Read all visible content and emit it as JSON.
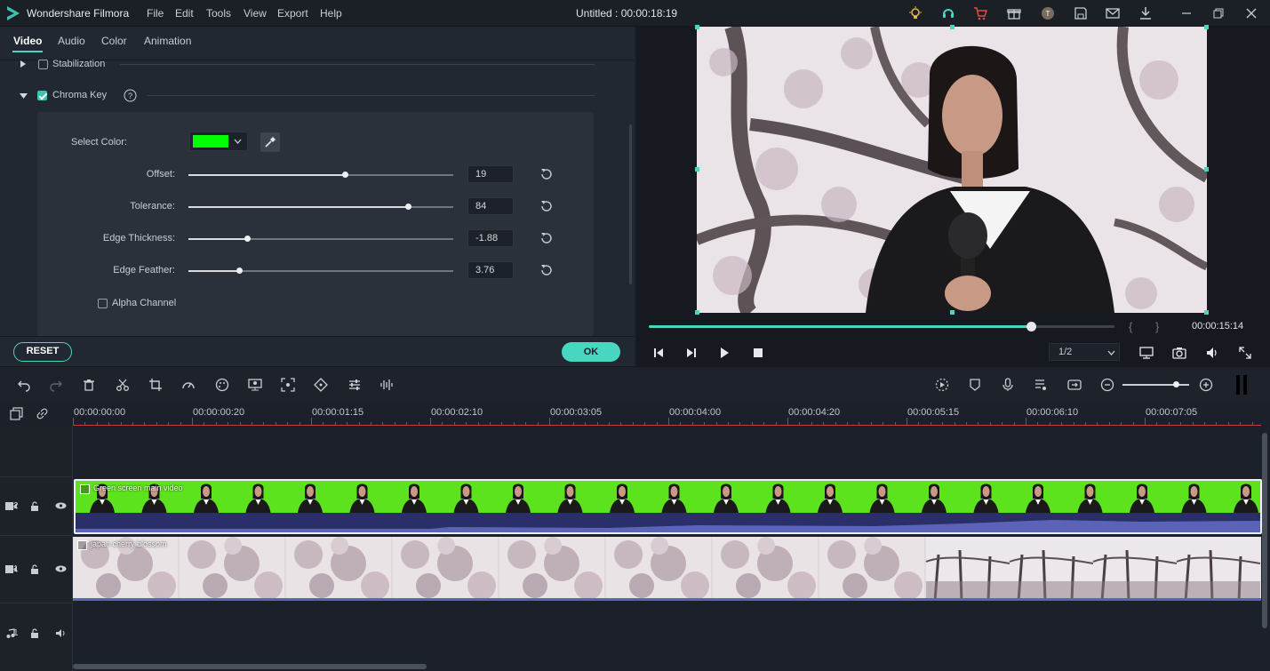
{
  "app": {
    "name": "Wondershare Filmora",
    "menu": [
      "File",
      "Edit",
      "Tools",
      "View",
      "Export",
      "Help"
    ],
    "document_title": "Untitled : 00:00:18:19"
  },
  "panel": {
    "tabs": [
      "Video",
      "Audio",
      "Color",
      "Animation"
    ],
    "active_tab": "Video",
    "stabilization_label": "Stabilization",
    "stabilization_checked": false,
    "chroma_key_label": "Chroma Key",
    "chroma_key_checked": true,
    "select_color_label": "Select Color:",
    "selected_color": "#00ff00",
    "params": [
      {
        "label": "Offset:",
        "value": "19",
        "fraction": 0.59
      },
      {
        "label": "Tolerance:",
        "value": "84",
        "fraction": 0.83
      },
      {
        "label": "Edge Thickness:",
        "value": "-1.88",
        "fraction": 0.22
      },
      {
        "label": "Edge Feather:",
        "value": "3.76",
        "fraction": 0.19
      }
    ],
    "alpha_channel_label": "Alpha Channel",
    "alpha_channel_checked": false,
    "reset_label": "RESET",
    "ok_label": "OK"
  },
  "preview": {
    "timecode": "00:00:15:14",
    "progress": 0.82,
    "ratio": "1/2",
    "bracket_left": "{",
    "bracket_right": "}"
  },
  "timeline": {
    "ruler_labels": [
      "00:00:00:00",
      "00:00:00:20",
      "00:00:01:15",
      "00:00:02:10",
      "00:00:03:05",
      "00:00:04:00",
      "00:00:04:20",
      "00:00:05:15",
      "00:00:06:10",
      "00:00:07:05"
    ],
    "tracks": [
      {
        "id": "2",
        "clip": "Green screen main video"
      },
      {
        "id": "1",
        "clip": "japan cherry blossom"
      },
      {
        "id": "1",
        "clip": ""
      }
    ]
  },
  "colors": {
    "accent": "#47d7c1",
    "playhead": "#c93b3b",
    "green_clip": "#5de21e"
  }
}
